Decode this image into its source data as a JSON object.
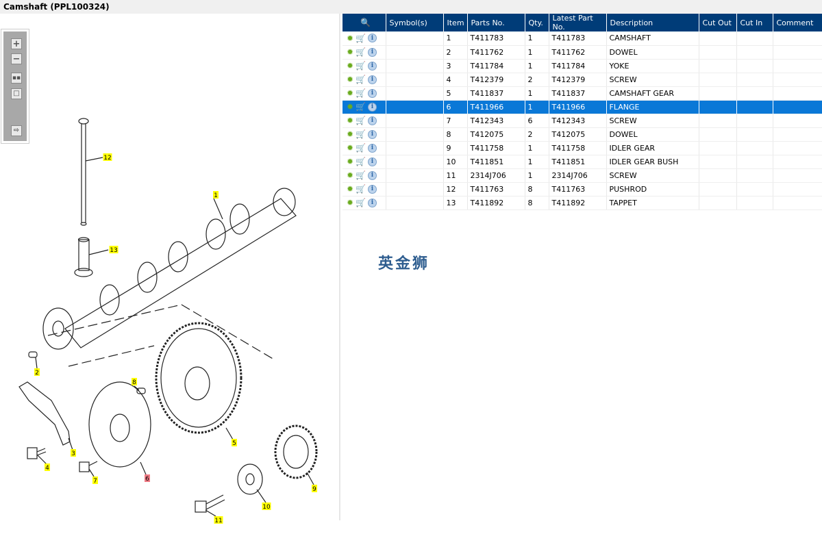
{
  "window": {
    "title": "Camshaft (PPL100324)"
  },
  "toolbar": {
    "zoom_in": "zoom-in-icon",
    "zoom_out": "zoom-out-icon",
    "fit": "fit-all-icon",
    "actual": "actual-size-icon",
    "export": "export-icon"
  },
  "diagram": {
    "callouts": [
      {
        "label": "12",
        "highlight": "#ffff00"
      },
      {
        "label": "1",
        "highlight": "#ffff00"
      },
      {
        "label": "13",
        "highlight": "#ffff00"
      },
      {
        "label": "2",
        "highlight": "#ffff00"
      },
      {
        "label": "8",
        "highlight": "#ffff00"
      },
      {
        "label": "3",
        "highlight": "#ffff00"
      },
      {
        "label": "4",
        "highlight": "#ffff00"
      },
      {
        "label": "5",
        "highlight": "#ffff00"
      },
      {
        "label": "6",
        "highlight": "#f07a84"
      },
      {
        "label": "7",
        "highlight": "#ffff00"
      },
      {
        "label": "9",
        "highlight": "#ffff00"
      },
      {
        "label": "10",
        "highlight": "#ffff00"
      },
      {
        "label": "11",
        "highlight": "#ffff00"
      }
    ]
  },
  "table": {
    "columns": [
      "",
      "Symbol(s)",
      "Item",
      "Parts No.",
      "Qty.",
      "Latest Part No.",
      "Description",
      "Cut Out",
      "Cut In",
      "Comment"
    ],
    "selected_item": "6",
    "rows": [
      [
        "1",
        "T411783",
        "1",
        "T411783",
        "CAMSHAFT"
      ],
      [
        "2",
        "T411762",
        "1",
        "T411762",
        "DOWEL"
      ],
      [
        "3",
        "T411784",
        "1",
        "T411784",
        "YOKE"
      ],
      [
        "4",
        "T412379",
        "2",
        "T412379",
        "SCREW"
      ],
      [
        "5",
        "T411837",
        "1",
        "T411837",
        "CAMSHAFT GEAR"
      ],
      [
        "6",
        "T411966",
        "1",
        "T411966",
        "FLANGE"
      ],
      [
        "7",
        "T412343",
        "6",
        "T412343",
        "SCREW"
      ],
      [
        "8",
        "T412075",
        "2",
        "T412075",
        "DOWEL"
      ],
      [
        "9",
        "T411758",
        "1",
        "T411758",
        "IDLER GEAR"
      ],
      [
        "10",
        "T411851",
        "1",
        "T411851",
        "IDLER GEAR BUSH"
      ],
      [
        "11",
        "2314J706",
        "1",
        "2314J706",
        "SCREW"
      ],
      [
        "12",
        "T411763",
        "8",
        "T411763",
        "PUSHROD"
      ],
      [
        "13",
        "T411892",
        "8",
        "T411892",
        "TAPPET"
      ]
    ]
  },
  "watermark": "英金狮",
  "colors": {
    "header": "#003c78",
    "selected": "#0a78d7"
  }
}
